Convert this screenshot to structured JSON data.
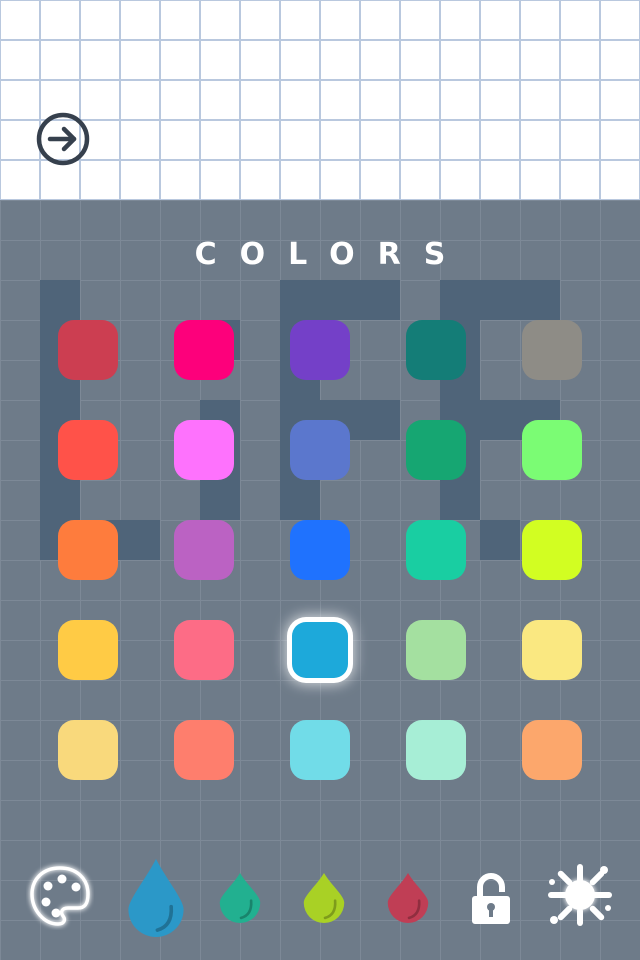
{
  "header": {
    "next_icon": "arrow-right-circle-icon"
  },
  "title": "COLORS",
  "swatch_rows": [
    [
      "#cc3e51",
      "#fd007b",
      "#7440c8",
      "#147d77",
      "#8e8c86"
    ],
    [
      "#ff5249",
      "#fe72fd",
      "#5b77cd",
      "#16a672",
      "#7bfc74"
    ],
    [
      "#fe7c3d",
      "#bb62c3",
      "#1f72fe",
      "#19cea2",
      "#d2fe22"
    ],
    [
      "#ffcb45",
      "#fd6c86",
      "#1da9da",
      "#a4e0a0",
      "#fae881"
    ],
    [
      "#f9d97c",
      "#fe7e6d",
      "#71dce8",
      "#a7eed6",
      "#fca76c"
    ]
  ],
  "selected_swatch": "#1da9da",
  "toolbar": {
    "items": [
      {
        "icon": "palette-icon",
        "color": "#ffffff"
      },
      {
        "icon": "drop-icon",
        "color": "#2b98c8"
      },
      {
        "icon": "drop-icon",
        "color": "#22b090"
      },
      {
        "icon": "drop-icon",
        "color": "#a9d125"
      },
      {
        "icon": "drop-icon",
        "color": "#c03e55"
      },
      {
        "icon": "lock-icon",
        "color": "#ffffff"
      },
      {
        "icon": "splat-icon",
        "color": "#ffffff"
      }
    ]
  }
}
